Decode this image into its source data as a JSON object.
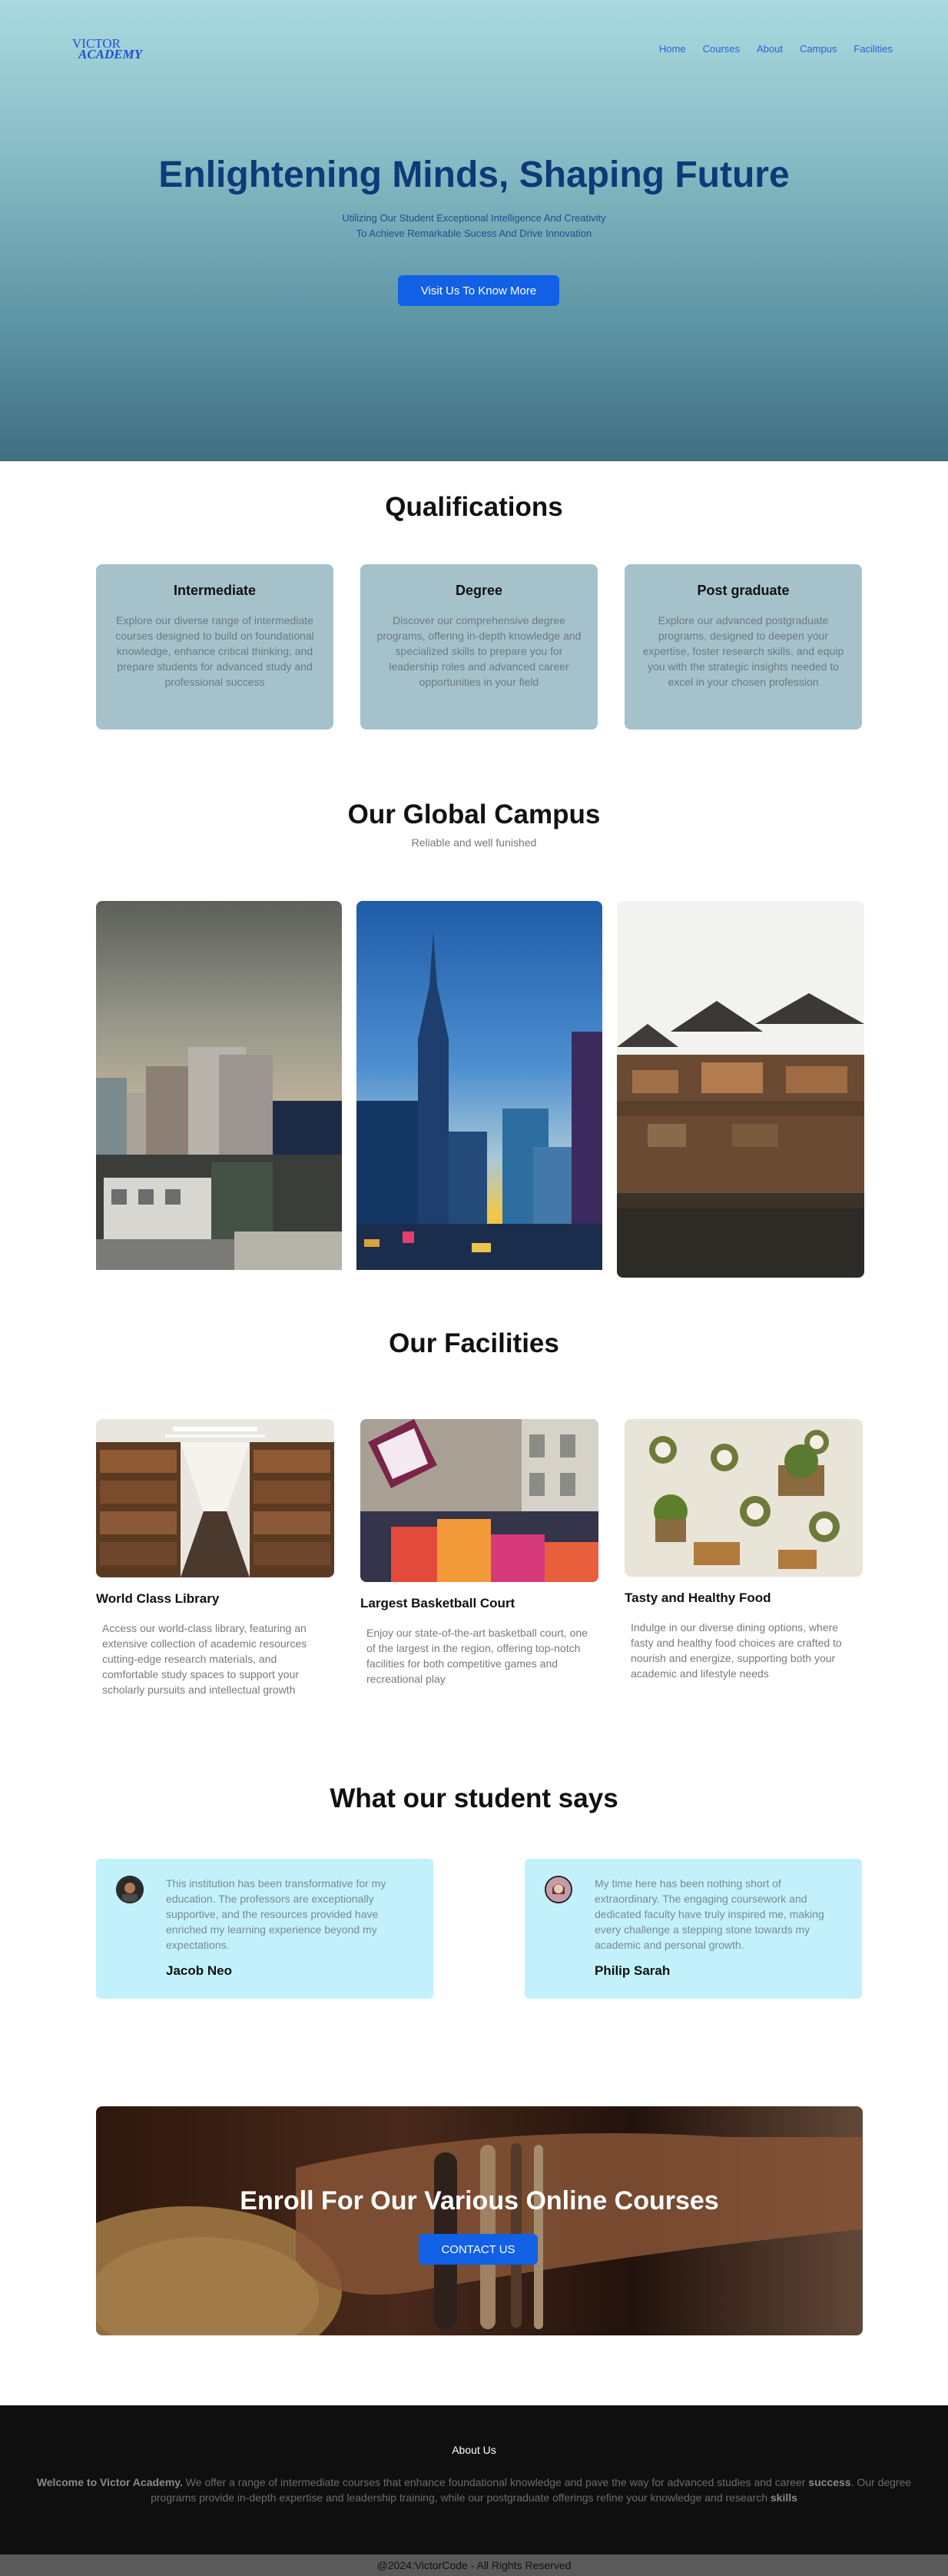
{
  "nav": {
    "logo_line1": "VICTOR",
    "logo_line2": "ACADEMY",
    "links": [
      "Home",
      "Courses",
      "About",
      "Campus",
      "Facilities"
    ]
  },
  "hero": {
    "title": "Enlightening Minds, Shaping Future",
    "subtitle_line1": "Utilizing Our Student Exceptional Intelligence And Creativity",
    "subtitle_line2": "To Achieve Remarkable Sucess And Drive Innovation",
    "cta_label": "Visit Us To Know More"
  },
  "qualifications": {
    "title": "Qualifications",
    "cards": [
      {
        "title": "Intermediate",
        "text": "Explore our diverse range of intermediate courses designed to build on foundational knowledge, enhance critical thinking, and prepare students for advanced study and professional success"
      },
      {
        "title": "Degree",
        "text": "Discover our comprehensive degree programs, offering in-depth knowledge and specialized skills to prepare you for leadership roles and advanced career opportunities in your field"
      },
      {
        "title": "Post graduate",
        "text": "Explore our advanced postgraduate programs, designed to deepen your expertise, foster research skills, and equip you with the strategic insights needed to excel in your chosen profession"
      }
    ]
  },
  "campus": {
    "title": "Our Global Campus",
    "caption": "Reliable and well funished"
  },
  "facilities": {
    "title": "Our Facilities",
    "items": [
      {
        "title": "World Class Library",
        "text": "Access our world-class library, featuring an extensive collection of academic resources cutting-edge research materials, and comfortable study spaces to support your scholarly pursuits and intellectual growth"
      },
      {
        "title": "Largest Basketball Court",
        "text": "Enjoy our state-of-the-art basketball court, one of the largest in the region, offering top-notch facilities for both competitive games and recreational play"
      },
      {
        "title": "Tasty and Healthy Food",
        "text": "Indulge in our diverse dining options, where fasty and healthy food choices are crafted to nourish and energize, supporting both your academic and lifestyle needs"
      }
    ]
  },
  "testimonials": {
    "title": "What our student says",
    "items": [
      {
        "text": "This institution has been transformative for my education. The professors are exceptionally supportive, and the resources provided have enriched my learning experience beyond my expectations.",
        "name": "Jacob Neo"
      },
      {
        "text": "My time here has been nothing short of extraordinary. The engaging coursework and dedicated faculty have truly inspired me, making every challenge a stepping stone towards my academic and personal growth.",
        "name": "Philip Sarah"
      }
    ]
  },
  "enroll": {
    "title": "Enroll For Our Various Online Courses",
    "button": "CONTACT US"
  },
  "footer": {
    "heading": "About Us",
    "bold_intro": "Welcome to Victor Academy.",
    "text_part1": " We offer a range of intermediate courses that enhance foundational knowledge and pave the way for advanced studies and career ",
    "bold_word1": "success",
    "text_part2": ". Our degree programs provide in-depth expertise and leadership training, while our postgraduate offerings refine your knowledge and research ",
    "bold_word2": "skills",
    "copyright": "@2024:VictorCode - All Rights Reserved"
  },
  "colors": {
    "accent": "#1160e6",
    "heading_blue": "#0d3a78",
    "card_bg": "#a5c2cb",
    "testimonial_bg": "#c2f1fb",
    "footer_bg": "#0f0f0f"
  }
}
